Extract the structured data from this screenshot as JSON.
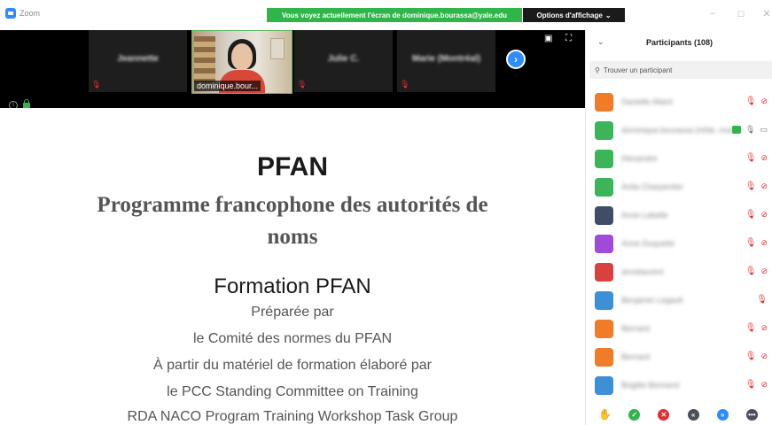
{
  "window": {
    "app_title": "Zoom",
    "share_banner": "Vous voyez actuellement l'écran de dominique.bourassa@yale.edu",
    "view_options_label": "Options d'affichage",
    "view_options_chevron": "⌄"
  },
  "video_strip": {
    "thumbnails": [
      {
        "name": "Jeannette",
        "muted": true
      },
      {
        "name": "dominique.bour...",
        "muted": false,
        "active": true
      },
      {
        "name": "Julie C.",
        "muted": true
      },
      {
        "name": "Marie (Montréal)",
        "muted": true
      }
    ],
    "next_icon": "next-page-icon"
  },
  "slide": {
    "title": "PFAN",
    "subtitle": "Programme francophone des autorités de noms",
    "formation_title": "Formation PFAN",
    "lines": [
      "Préparée par",
      "le Comité des normes du PFAN",
      "À partir du matériel de formation élaboré par",
      "le PCC Standing Committee on Training",
      "RDA NACO Program Training Workshop Task Group"
    ]
  },
  "participants_panel": {
    "title": "Participants (108)",
    "search_placeholder": "Trouver un participant",
    "participants": [
      {
        "name": "Danielle Allard",
        "avatar_color": "#f07c2a",
        "muted": true,
        "video_off": true
      },
      {
        "name": "dominique.bourassa (Hôte, moi)",
        "avatar_color": "#3cb45a",
        "sharing": true,
        "mic_on": true,
        "cam_on": true
      },
      {
        "name": "Alexandre",
        "avatar_color": "#3cb45a",
        "muted": true,
        "video_off": true
      },
      {
        "name": "Anita Charpentier",
        "avatar_color": "#3cb45a",
        "muted": true,
        "video_off": true
      },
      {
        "name": "Anne Labelle",
        "avatar_color": "#3f4d66",
        "muted": true,
        "video_off": true
      },
      {
        "name": "Anne Duquette",
        "avatar_color": "#a04ad8",
        "muted": true,
        "video_off": true
      },
      {
        "name": "annelaurent",
        "avatar_color": "#d9413e",
        "muted": true,
        "video_off": true
      },
      {
        "name": "Benjamin Legault",
        "avatar_color": "#3d8fd6",
        "muted": true,
        "video_off": false
      },
      {
        "name": "Bernard",
        "avatar_color": "#f07c2a",
        "muted": true,
        "video_off": true
      },
      {
        "name": "Bernard",
        "avatar_color": "#f07c2a",
        "muted": true,
        "video_off": true
      },
      {
        "name": "Brigitte Bertrand",
        "avatar_color": "#3d8fd6",
        "muted": true,
        "video_off": true
      }
    ]
  },
  "reactions": [
    {
      "name": "raise-hand",
      "color": "#2d8cff",
      "glyph": "✋"
    },
    {
      "name": "yes",
      "color": "#2fb54a",
      "glyph": "✓"
    },
    {
      "name": "no",
      "color": "#e03131",
      "glyph": "✕"
    },
    {
      "name": "go-slower",
      "color": "#4a4f5a",
      "glyph": "«"
    },
    {
      "name": "go-faster",
      "color": "#2d8cff",
      "glyph": "»"
    },
    {
      "name": "more",
      "color": "#4a4f5a",
      "glyph": "•••"
    }
  ],
  "colors": {
    "banner_green": "#2fb54a",
    "zoom_blue": "#2d8cff",
    "muted_red": "#e03131"
  }
}
